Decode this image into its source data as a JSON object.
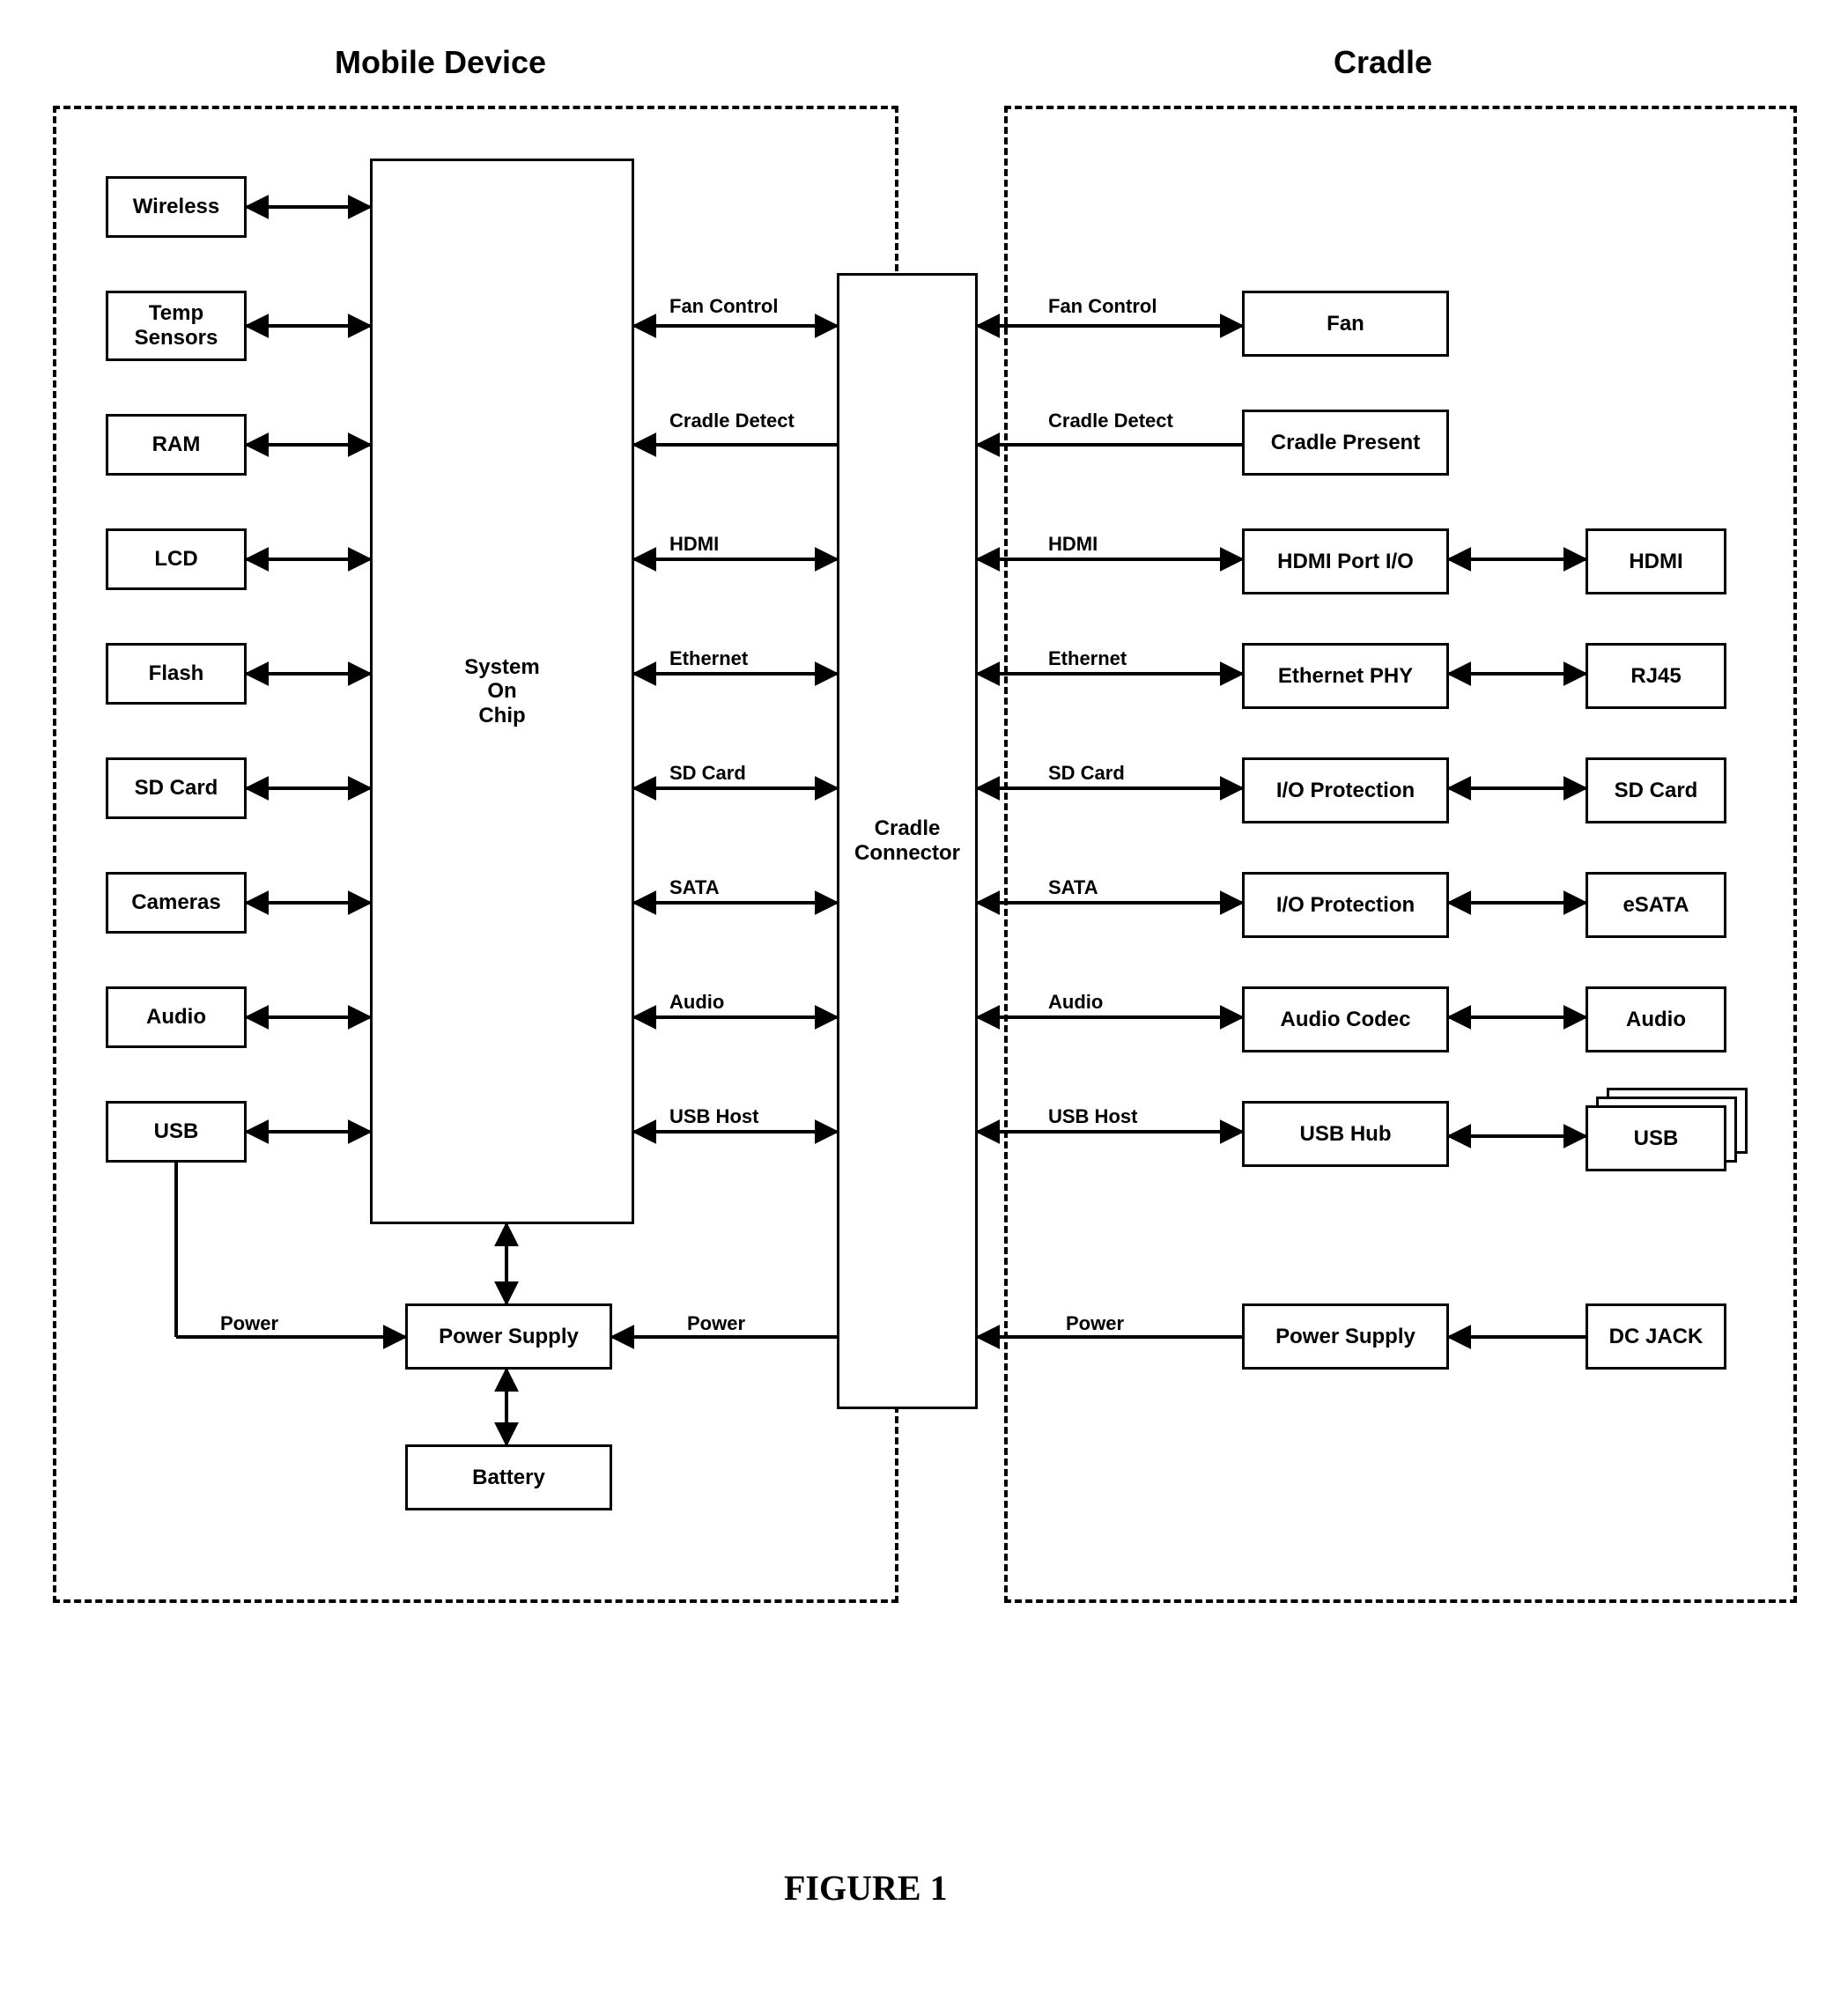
{
  "titles": {
    "mobile": "Mobile Device",
    "cradle": "Cradle"
  },
  "figure": "FIGURE 1",
  "mobile": {
    "soc": "System\nOn\nChip",
    "power_supply": "Power Supply",
    "battery": "Battery",
    "blocks": [
      "Wireless",
      "Temp\nSensors",
      "RAM",
      "LCD",
      "Flash",
      "SD Card",
      "Cameras",
      "Audio",
      "USB"
    ],
    "signals": [
      "Fan Control",
      "Cradle Detect",
      "HDMI",
      "Ethernet",
      "SD Card",
      "SATA",
      "Audio",
      "USB Host"
    ],
    "power_label": "Power"
  },
  "connector": "Cradle\nConnector",
  "cradle": {
    "signals": [
      "Fan Control",
      "Cradle Detect",
      "HDMI",
      "Ethernet",
      "SD Card",
      "SATA",
      "Audio",
      "USB Host"
    ],
    "power_label": "Power",
    "mid": [
      "Fan",
      "Cradle Present",
      "HDMI Port I/O",
      "Ethernet PHY",
      "I/O Protection",
      "I/O Protection",
      "Audio Codec",
      "USB Hub",
      "Power Supply"
    ],
    "right": [
      "",
      "",
      "HDMI",
      "RJ45",
      "SD Card",
      "eSATA",
      "Audio",
      "USB",
      "DC JACK"
    ]
  }
}
